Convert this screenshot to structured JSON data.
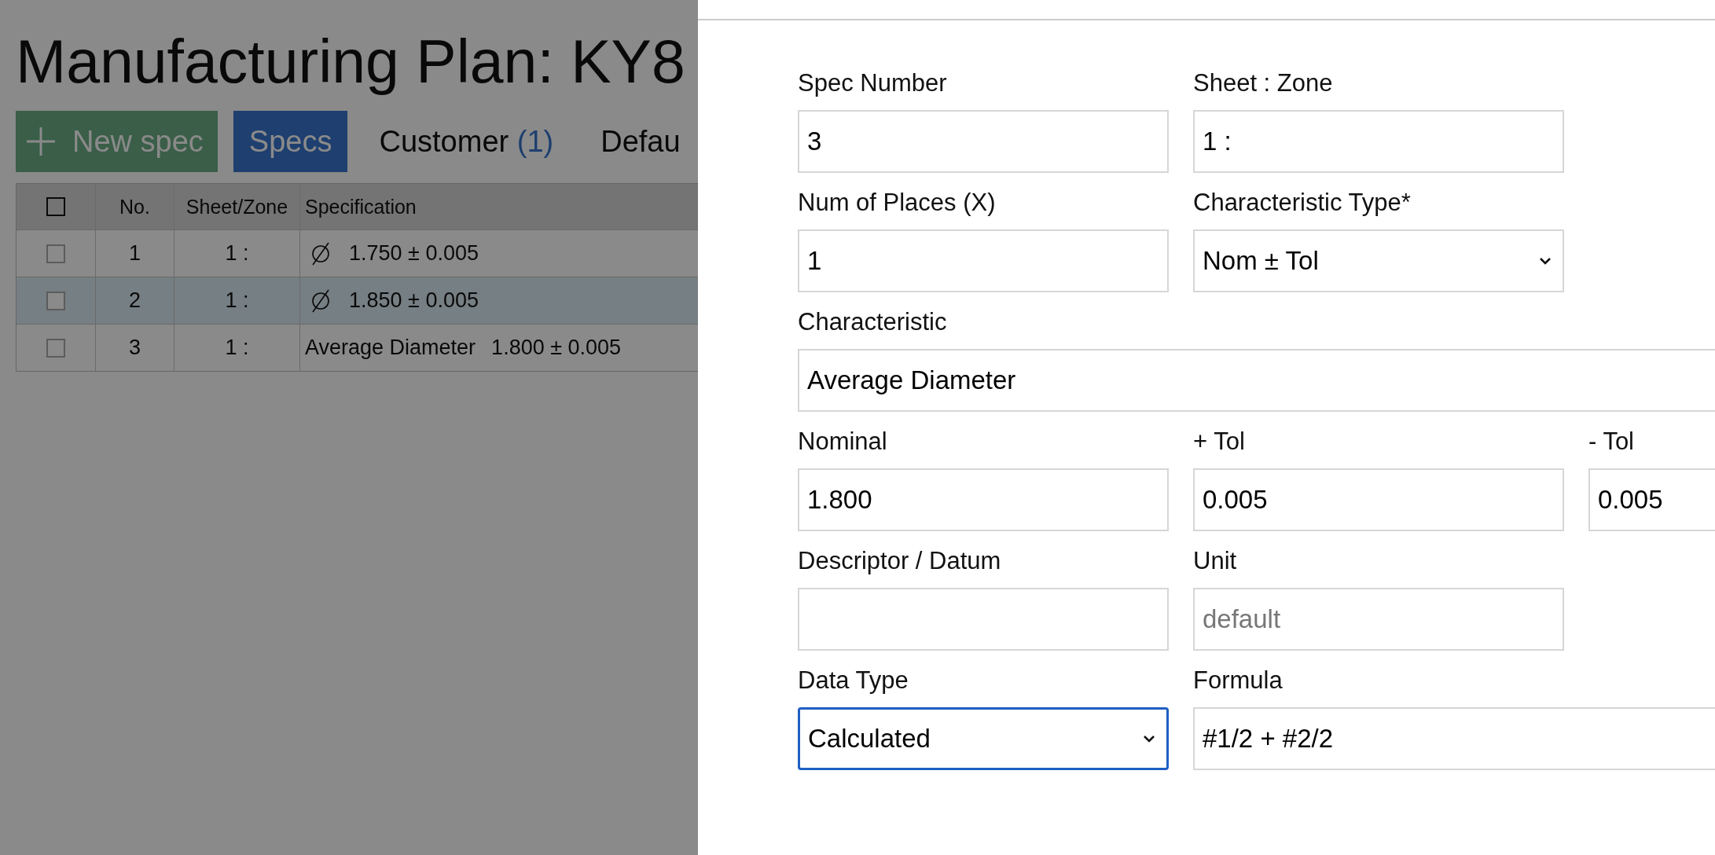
{
  "page": {
    "title": "Manufacturing Plan: KY8"
  },
  "new_button": {
    "label": "New spec"
  },
  "tabs": [
    {
      "label": "Specs",
      "selected": true
    },
    {
      "label": "Customer",
      "count": "(1)",
      "selected": false
    },
    {
      "label": "Defau",
      "selected": false
    }
  ],
  "table": {
    "columns": [
      "No.",
      "Sheet/Zone",
      "Specification"
    ],
    "header_checked": false,
    "rows": [
      {
        "checked": false,
        "highlighted": false,
        "no": "1",
        "sheet_zone": "1 :",
        "spec": {
          "kind": "diameter",
          "value": "1.750 ± 0.005"
        }
      },
      {
        "checked": false,
        "highlighted": true,
        "no": "2",
        "sheet_zone": "1 :",
        "spec": {
          "kind": "diameter",
          "value": "1.850 ± 0.005"
        }
      },
      {
        "checked": false,
        "highlighted": false,
        "no": "3",
        "sheet_zone": "1 :",
        "spec": {
          "kind": "named",
          "name": "Average Diameter",
          "value": "1.800 ± 0.005"
        }
      }
    ]
  },
  "form": {
    "rows": [
      {
        "fields": [
          {
            "label": "Spec Number",
            "kind": "text",
            "value": "3",
            "focused": false
          },
          {
            "label": "Sheet : Zone",
            "kind": "text",
            "value": "1 :",
            "focused": false
          }
        ]
      },
      {
        "fields": [
          {
            "label": "Num of Places (X)",
            "kind": "text",
            "value": "1",
            "focused": false
          },
          {
            "label": "Characteristic Type*",
            "kind": "select",
            "value": "Nom ± Tol",
            "focused": false
          }
        ]
      },
      {
        "fields": [
          {
            "label": "Characteristic",
            "kind": "wide",
            "value": "Average Diameter",
            "focused": false
          }
        ]
      },
      {
        "fields": [
          {
            "label": "Nominal",
            "kind": "text",
            "value": "1.800",
            "focused": false
          },
          {
            "label": "+ Tol",
            "kind": "text",
            "value": "0.005",
            "focused": false
          },
          {
            "label": "- Tol",
            "kind": "text",
            "value": "0.005",
            "focused": false
          }
        ]
      },
      {
        "fields": [
          {
            "label": "Descriptor / Datum",
            "kind": "text",
            "focused": false
          },
          {
            "label": "Unit",
            "kind": "text",
            "placeholder": "default",
            "focused": false
          }
        ]
      },
      {
        "fields": [
          {
            "label": "Data Type",
            "kind": "select",
            "value": "Calculated",
            "focused": true
          },
          {
            "label": "Formula",
            "kind": "wide",
            "value": "#1/2 + #2/2",
            "focused": false
          }
        ]
      }
    ]
  }
}
